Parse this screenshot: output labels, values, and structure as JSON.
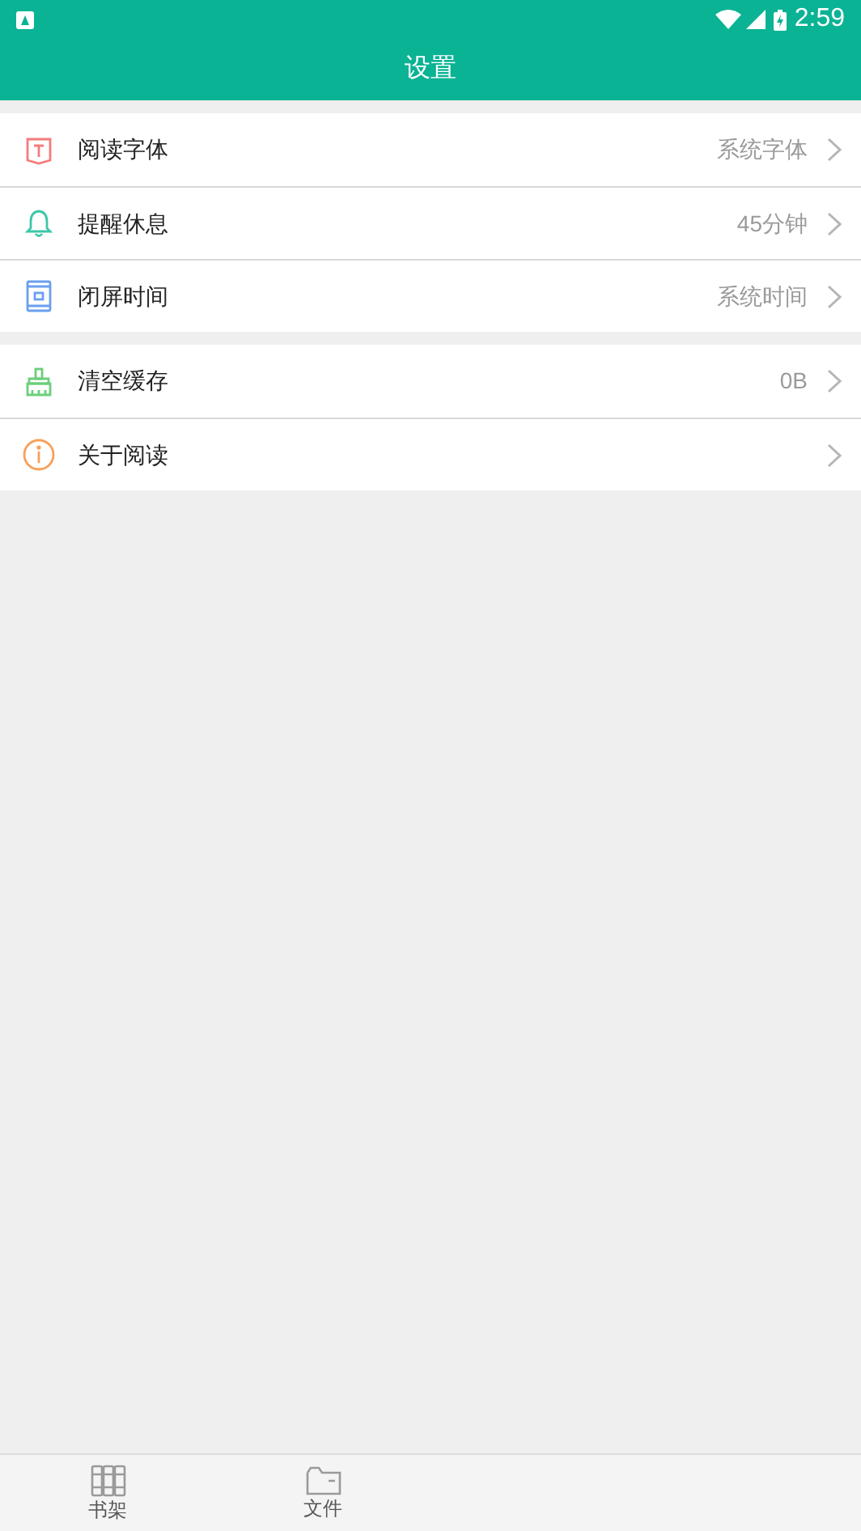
{
  "status_bar": {
    "time": "2:59"
  },
  "header": {
    "title": "设置"
  },
  "sections": [
    {
      "items": [
        {
          "kind": "font",
          "label": "阅读字体",
          "value": "系统字体"
        },
        {
          "kind": "bell",
          "label": "提醒休息",
          "value": "45分钟"
        },
        {
          "kind": "screen",
          "label": "闭屏时间",
          "value": "系统时间"
        }
      ]
    },
    {
      "items": [
        {
          "kind": "broom",
          "label": "清空缓存",
          "value": "0B"
        },
        {
          "kind": "info",
          "label": "关于阅读"
        }
      ]
    }
  ],
  "tab_bar": [
    {
      "kind": "books",
      "label": "书架"
    },
    {
      "kind": "folder",
      "label": "文件"
    }
  ]
}
